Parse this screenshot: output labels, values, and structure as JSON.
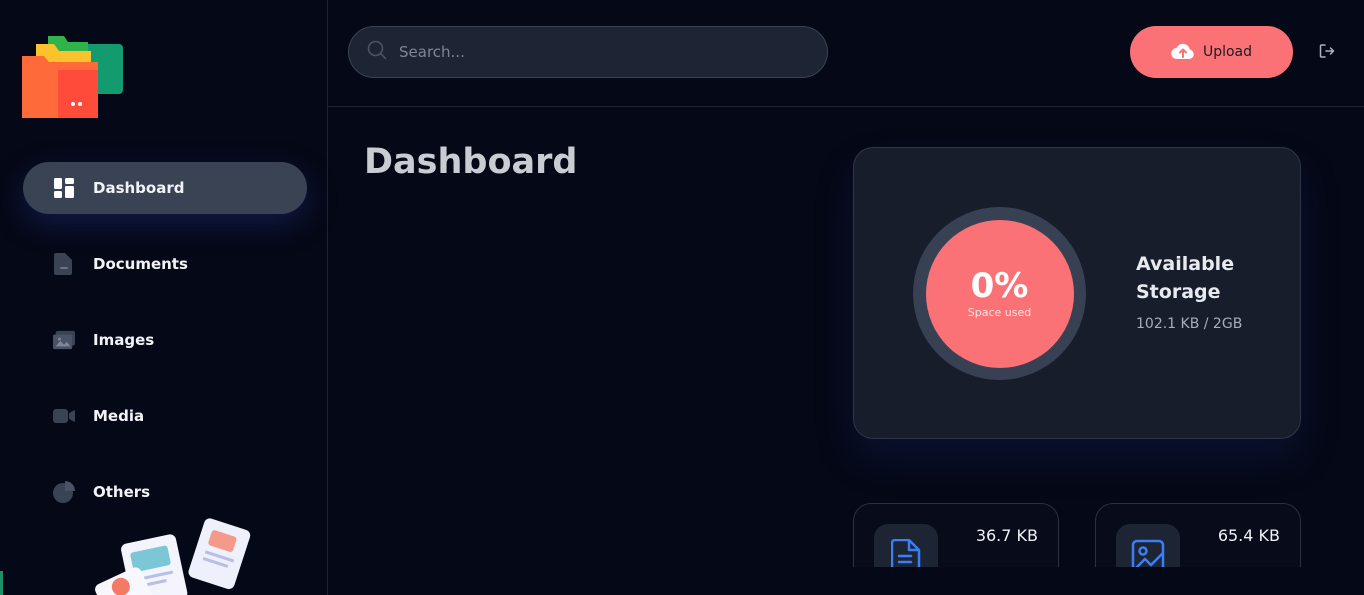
{
  "sidebar": {
    "items": [
      {
        "label": "Dashboard",
        "icon": "dashboard-icon",
        "active": true
      },
      {
        "label": "Documents",
        "icon": "documents-icon",
        "active": false
      },
      {
        "label": "Images",
        "icon": "images-icon",
        "active": false
      },
      {
        "label": "Media",
        "icon": "media-icon",
        "active": false
      },
      {
        "label": "Others",
        "icon": "others-icon",
        "active": false
      }
    ]
  },
  "header": {
    "search_placeholder": "Search...",
    "upload_label": "Upload"
  },
  "main": {
    "title": "Dashboard",
    "storage": {
      "percent": "0%",
      "percent_caption": "Space used",
      "title": "Available Storage",
      "usage": "102.1 KB / 2GB"
    },
    "summary": [
      {
        "size": "36.7 KB",
        "icon": "document-icon"
      },
      {
        "size": "65.4 KB",
        "icon": "image-icon"
      }
    ]
  },
  "colors": {
    "accent": "#fa7275",
    "background": "#050816",
    "card": "#171d2a",
    "icon_blue": "#3d7ef5"
  }
}
